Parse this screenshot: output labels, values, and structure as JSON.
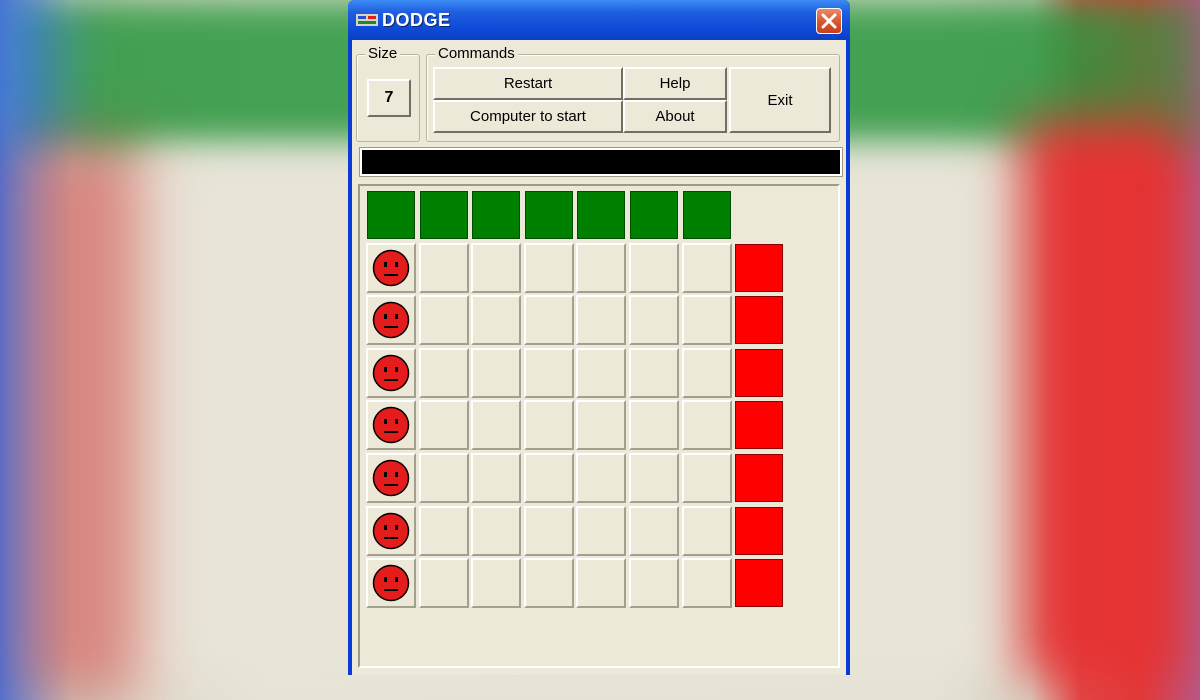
{
  "window": {
    "title": "DODGE"
  },
  "size_group": {
    "label": "Size",
    "value": "7"
  },
  "commands": {
    "label": "Commands",
    "restart": "Restart",
    "help": "Help",
    "computer_start": "Computer to start",
    "about": "About",
    "exit": "Exit"
  },
  "status": {
    "text": ""
  },
  "colors": {
    "red_piece": "#e51c1c",
    "green_piece": "#1f8a1f",
    "selected_green_piece": "#3bef3b",
    "top_goal": "#008000",
    "right_goal": "#ff0000",
    "status_bar": "#000000"
  },
  "board": {
    "size": 7,
    "red_pieces_column": 0,
    "red_piece_rows": [
      0,
      1,
      2,
      3,
      4,
      5,
      6
    ],
    "green_pieces_row": 7,
    "green_piece_columns": [
      1,
      2,
      3,
      4,
      5,
      6,
      7
    ],
    "selected_green_column": 1
  }
}
